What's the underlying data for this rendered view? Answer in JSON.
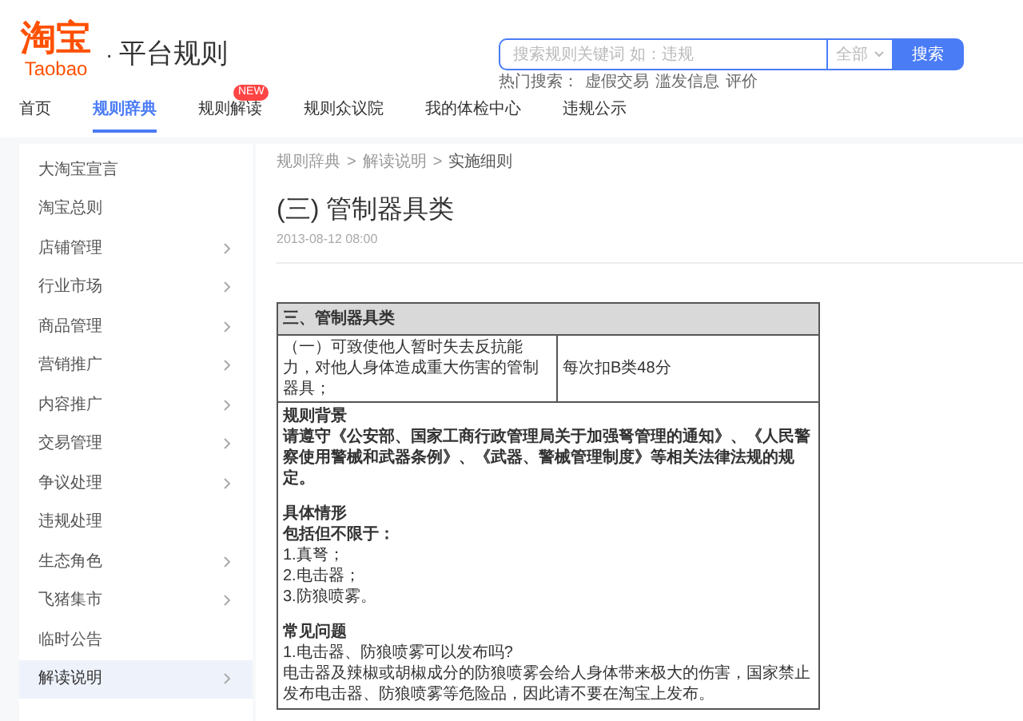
{
  "header": {
    "logo": {
      "mark": "淘宝",
      "word": "Taobao"
    },
    "separator": "·",
    "site_title": "平台规则",
    "search": {
      "placeholder": "搜索规则关键词 如：违规",
      "scope": "全部",
      "button": "搜索"
    },
    "hot_searches": {
      "label": "热门搜索：",
      "terms": [
        "虚假交易",
        "滥发信息",
        "评价"
      ]
    }
  },
  "nav": [
    {
      "label": "首页",
      "selected": false
    },
    {
      "label": "规则辞典",
      "selected": true
    },
    {
      "label": "规则解读",
      "selected": false,
      "badge": "NEW"
    },
    {
      "label": "规则众议院",
      "selected": false
    },
    {
      "label": "我的体检中心",
      "selected": false
    },
    {
      "label": "违规公示",
      "selected": false
    }
  ],
  "sidebar": {
    "items": [
      {
        "label": "大淘宝宣言",
        "expandable": false,
        "selected": false
      },
      {
        "label": "淘宝总则",
        "expandable": false,
        "selected": false
      },
      {
        "label": "店铺管理",
        "expandable": true,
        "selected": false
      },
      {
        "label": "行业市场",
        "expandable": true,
        "selected": false
      },
      {
        "label": "商品管理",
        "expandable": true,
        "selected": false
      },
      {
        "label": "营销推广",
        "expandable": true,
        "selected": false
      },
      {
        "label": "内容推广",
        "expandable": true,
        "selected": false
      },
      {
        "label": "交易管理",
        "expandable": true,
        "selected": false
      },
      {
        "label": "争议处理",
        "expandable": true,
        "selected": false
      },
      {
        "label": "违规处理",
        "expandable": false,
        "selected": false
      },
      {
        "label": "生态角色",
        "expandable": true,
        "selected": false
      },
      {
        "label": "飞猪集市",
        "expandable": true,
        "selected": false
      },
      {
        "label": "临时公告",
        "expandable": false,
        "selected": false
      },
      {
        "label": "解读说明",
        "expandable": true,
        "selected": true
      }
    ]
  },
  "article": {
    "breadcrumb": [
      "规则辞典",
      "解读说明",
      "实施细则"
    ],
    "breadcrumb_separator": ">",
    "title": "(三) 管制器具类",
    "date": "2013-08-12 08:00",
    "table": {
      "heading": "三、管制器具类",
      "rows": [
        {
          "violation": "（一）可致使他人暂时失去反抗能力，对他人身体造成重大伤害的管制器具；",
          "penalty": "每次扣B类48分"
        }
      ],
      "sections": [
        {
          "heading": "规则背景",
          "paragraphs": [
            {
              "text": "请遵守《公安部、国家工商行政管理局关于加强弩管理的通知》、《人民警察使用警械和武器条例》、《武器、警械管理制度》等相关法律法规的规定。",
              "bold": true
            }
          ]
        },
        {
          "heading": "具体情形",
          "paragraphs": [
            {
              "text": "包括但不限于：",
              "bold": true
            },
            {
              "text": "1.真弩；",
              "bold": false
            },
            {
              "text": "2.电击器；",
              "bold": false
            },
            {
              "text": "3.防狼喷雾。",
              "bold": false
            }
          ]
        },
        {
          "heading": "常见问题",
          "paragraphs": [
            {
              "text": "1.电击器、防狼喷雾可以发布吗?",
              "bold": false
            },
            {
              "text": "电击器及辣椒或胡椒成分的防狼喷雾会给人身体带来极大的伤害，国家禁止发布电击器、防狼喷雾等危险品，因此请不要在淘宝上发布。",
              "bold": false
            }
          ]
        }
      ]
    }
  }
}
